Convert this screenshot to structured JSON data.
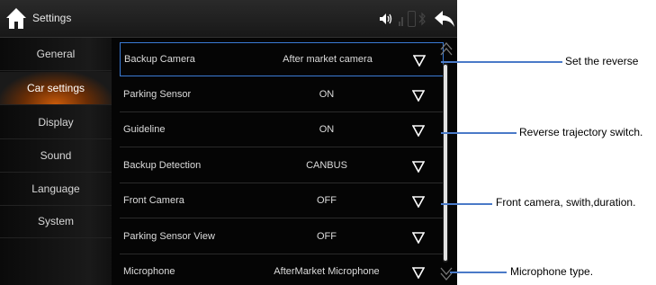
{
  "header": {
    "title": "Settings"
  },
  "sidebar": {
    "items": [
      {
        "label": "General"
      },
      {
        "label": "Car settings"
      },
      {
        "label": "Display"
      },
      {
        "label": "Sound"
      },
      {
        "label": "Language"
      },
      {
        "label": "System"
      }
    ],
    "active_index": 1
  },
  "settings": {
    "rows": [
      {
        "label": "Backup Camera",
        "value": "After market camera"
      },
      {
        "label": "Parking Sensor",
        "value": "ON"
      },
      {
        "label": "Guideline",
        "value": "ON"
      },
      {
        "label": "Backup Detection",
        "value": "CANBUS"
      },
      {
        "label": "Front Camera",
        "value": "OFF"
      },
      {
        "label": "Parking Sensor View",
        "value": "OFF"
      },
      {
        "label": "Microphone",
        "value": "AfterMarket Microphone"
      }
    ]
  },
  "annotations": [
    {
      "text": "Set the reverse"
    },
    {
      "text": "Reverse trajectory switch."
    },
    {
      "text": "Front camera, swith,duration."
    },
    {
      "text": "Microphone type."
    }
  ],
  "colors": {
    "accent": "#c85a0a",
    "callout": "#4a7ac8",
    "selection": "#3a7bd5"
  }
}
